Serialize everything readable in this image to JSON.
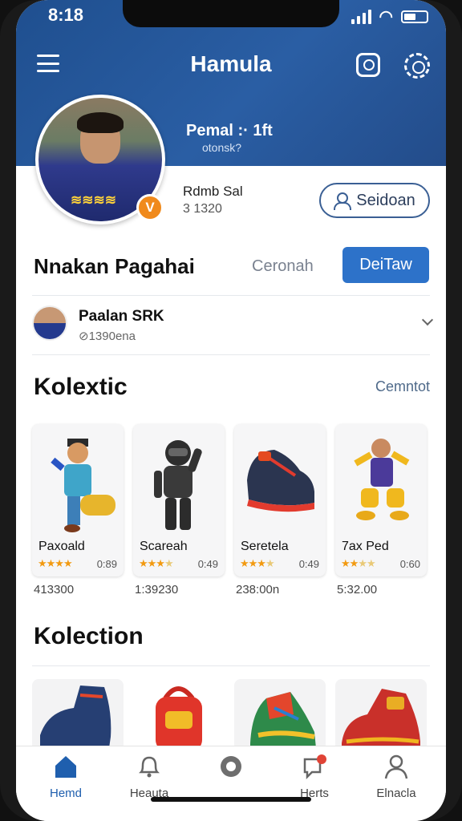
{
  "status": {
    "time": "8:18"
  },
  "header": {
    "title": "Hamula"
  },
  "profile": {
    "name": "Pemal :· 1ft",
    "handle": "otonsk?",
    "badge": "V",
    "stat_label": "Rdmb Sal",
    "stat_value": "3 1320",
    "follow_label": "Seidoan"
  },
  "section1": {
    "title": "Nnakan Pagahai",
    "secondary_label": "Ceronah",
    "primary_label": "DeiTaw"
  },
  "user_row": {
    "title": "Paalan SRK",
    "subtitle": "⊘1390ena"
  },
  "collection1": {
    "title": "Kolextic",
    "see_all": "Cemntot",
    "cards": [
      {
        "name": "Paxoald",
        "rating": 4,
        "value": "0:89",
        "count": "413300",
        "art": "figure-icon"
      },
      {
        "name": "Scareah",
        "rating": 3,
        "value": "0:49",
        "count": "1:39230",
        "art": "astronaut-icon"
      },
      {
        "name": "Seretela",
        "rating": 3,
        "value": "0:49",
        "count": "238:00n",
        "art": "sneaker-icon"
      },
      {
        "name": "7ax Ped",
        "rating": 3,
        "value": "0:60",
        "count": "5:32.00",
        "art": "player-icon"
      }
    ]
  },
  "collection2": {
    "title": "Kolection",
    "cards": [
      "boot-icon",
      "backpack-icon",
      "hightop-icon",
      "shoe-icon"
    ]
  },
  "tabs": [
    {
      "label": "Hemd",
      "icon": "home-icon",
      "active": true
    },
    {
      "label": "Heauta",
      "icon": "bell-icon",
      "active": false
    },
    {
      "label": "",
      "icon": "circle-icon",
      "active": false
    },
    {
      "label": "Herts",
      "icon": "chat-icon",
      "active": false
    },
    {
      "label": "Elnacla",
      "icon": "profile-icon",
      "active": false
    }
  ],
  "colors": {
    "accent": "#2d72c9",
    "header": "#2a5ea4",
    "star": "#f29a11"
  }
}
